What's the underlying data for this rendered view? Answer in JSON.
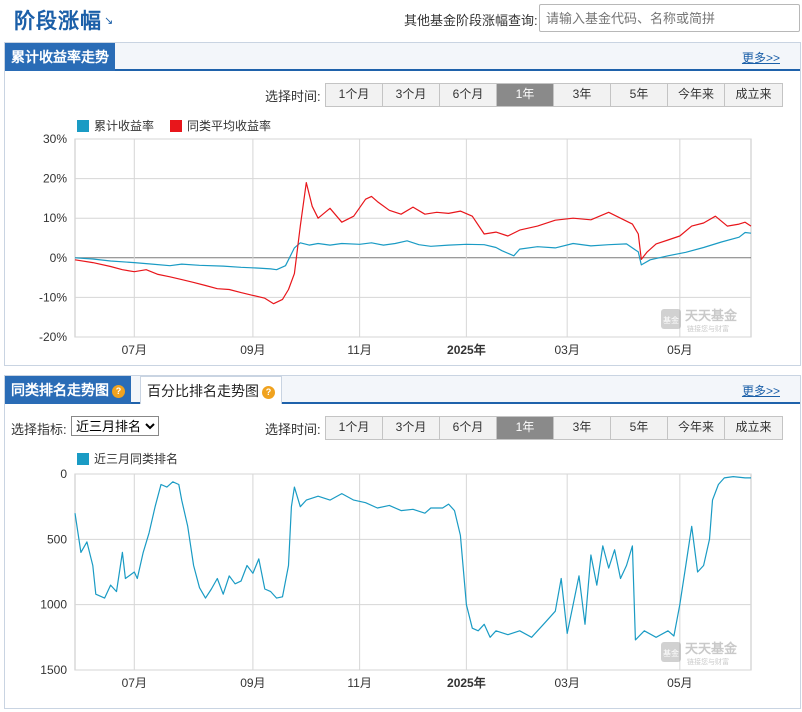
{
  "header": {
    "title": "阶段涨幅",
    "query_label": "其他基金阶段涨幅查询:",
    "query_placeholder": "请输入基金代码、名称或简拼"
  },
  "panel1": {
    "tab": "累计收益率走势",
    "more": "更多>>",
    "range_label": "选择时间:",
    "ranges": [
      "1个月",
      "3个月",
      "6个月",
      "1年",
      "3年",
      "5年",
      "今年来",
      "成立来"
    ],
    "active_range": "1年"
  },
  "panel2": {
    "tab_active": "同类排名走势图",
    "tab_other": "百分比排名走势图",
    "more": "更多>>",
    "metric_label": "选择指标:",
    "metric_value": "近三月排名",
    "range_label": "选择时间:",
    "ranges": [
      "1个月",
      "3个月",
      "6个月",
      "1年",
      "3年",
      "5年",
      "今年来",
      "成立来"
    ],
    "active_range": "1年"
  },
  "watermark": {
    "text": "天天基金",
    "sub": "链接您与财富",
    "badge": "基金"
  },
  "colors": {
    "blue_series": "#1a9bc4",
    "red_series": "#e8161b",
    "tab_blue": "#2a6cb6",
    "title_blue": "#1b5fa8"
  },
  "chart_data": [
    {
      "type": "line",
      "title": "累计收益率走势",
      "xlabel": "",
      "ylabel": "",
      "ylim": [
        -20,
        30
      ],
      "yticks": [
        "30%",
        "20%",
        "10%",
        "0%",
        "-10%",
        "-20%"
      ],
      "ytick_values": [
        30,
        20,
        10,
        0,
        -10,
        -20
      ],
      "xtick_labels": [
        "07月",
        "09月",
        "11月",
        "2025年",
        "03月",
        "05月"
      ],
      "xtick_positions": [
        1.0,
        3.0,
        4.8,
        6.6,
        8.3,
        10.2
      ],
      "xlim": [
        0,
        11.4
      ],
      "grid": true,
      "legend_position": "top-left",
      "series": [
        {
          "name": "累计收益率",
          "color": "#1a9bc4",
          "points": [
            [
              0,
              0
            ],
            [
              0.3,
              -0.3
            ],
            [
              0.6,
              -0.8
            ],
            [
              1.0,
              -1.2
            ],
            [
              1.3,
              -1.6
            ],
            [
              1.6,
              -2.0
            ],
            [
              1.8,
              -1.6
            ],
            [
              2.1,
              -1.9
            ],
            [
              2.5,
              -2.1
            ],
            [
              2.8,
              -2.4
            ],
            [
              3.1,
              -2.6
            ],
            [
              3.3,
              -2.8
            ],
            [
              3.4,
              -3.0
            ],
            [
              3.55,
              -2.0
            ],
            [
              3.7,
              2.5
            ],
            [
              3.8,
              3.8
            ],
            [
              3.95,
              3.2
            ],
            [
              4.1,
              3.6
            ],
            [
              4.3,
              3.2
            ],
            [
              4.5,
              3.6
            ],
            [
              4.8,
              3.4
            ],
            [
              5.0,
              3.8
            ],
            [
              5.2,
              3.2
            ],
            [
              5.4,
              3.6
            ],
            [
              5.6,
              4.3
            ],
            [
              5.8,
              3.3
            ],
            [
              6.0,
              2.9
            ],
            [
              6.3,
              3.2
            ],
            [
              6.6,
              3.4
            ],
            [
              6.9,
              3.3
            ],
            [
              7.1,
              2.6
            ],
            [
              7.2,
              1.8
            ],
            [
              7.4,
              0.5
            ],
            [
              7.5,
              2.2
            ],
            [
              7.8,
              2.8
            ],
            [
              8.1,
              2.5
            ],
            [
              8.4,
              3.6
            ],
            [
              8.7,
              3.0
            ],
            [
              9.0,
              3.3
            ],
            [
              9.3,
              3.5
            ],
            [
              9.5,
              1.5
            ],
            [
              9.55,
              -1.8
            ],
            [
              9.7,
              -0.5
            ],
            [
              10.0,
              0.5
            ],
            [
              10.3,
              1.4
            ],
            [
              10.6,
              2.6
            ],
            [
              10.9,
              4.0
            ],
            [
              11.2,
              5.2
            ],
            [
              11.3,
              6.4
            ],
            [
              11.4,
              6.2
            ]
          ]
        },
        {
          "name": "同类平均收益率",
          "color": "#e8161b",
          "points": [
            [
              0,
              -0.5
            ],
            [
              0.3,
              -1.2
            ],
            [
              0.6,
              -2.2
            ],
            [
              0.8,
              -3.0
            ],
            [
              1.0,
              -3.5
            ],
            [
              1.2,
              -3.0
            ],
            [
              1.4,
              -4.2
            ],
            [
              1.6,
              -4.8
            ],
            [
              1.8,
              -5.5
            ],
            [
              2.0,
              -6.2
            ],
            [
              2.2,
              -7.0
            ],
            [
              2.4,
              -7.8
            ],
            [
              2.6,
              -8.0
            ],
            [
              2.8,
              -8.8
            ],
            [
              3.0,
              -9.5
            ],
            [
              3.2,
              -10.2
            ],
            [
              3.35,
              -11.6
            ],
            [
              3.5,
              -10.5
            ],
            [
              3.6,
              -8.0
            ],
            [
              3.7,
              -4.0
            ],
            [
              3.8,
              8.0
            ],
            [
              3.9,
              19.0
            ],
            [
              4.0,
              13.0
            ],
            [
              4.1,
              10.0
            ],
            [
              4.3,
              12.5
            ],
            [
              4.5,
              9.0
            ],
            [
              4.7,
              10.5
            ],
            [
              4.9,
              14.8
            ],
            [
              5.0,
              15.5
            ],
            [
              5.1,
              14.2
            ],
            [
              5.3,
              12.0
            ],
            [
              5.5,
              11.0
            ],
            [
              5.7,
              12.8
            ],
            [
              5.9,
              11.0
            ],
            [
              6.1,
              11.5
            ],
            [
              6.3,
              11.2
            ],
            [
              6.5,
              11.8
            ],
            [
              6.7,
              10.5
            ],
            [
              6.9,
              6.0
            ],
            [
              7.1,
              6.5
            ],
            [
              7.3,
              5.5
            ],
            [
              7.5,
              7.0
            ],
            [
              7.8,
              8.0
            ],
            [
              8.1,
              9.5
            ],
            [
              8.4,
              10.0
            ],
            [
              8.7,
              9.6
            ],
            [
              9.0,
              11.5
            ],
            [
              9.2,
              10.0
            ],
            [
              9.4,
              8.5
            ],
            [
              9.5,
              6.0
            ],
            [
              9.55,
              -0.4
            ],
            [
              9.65,
              1.5
            ],
            [
              9.8,
              3.5
            ],
            [
              10.0,
              4.5
            ],
            [
              10.2,
              5.5
            ],
            [
              10.4,
              8.0
            ],
            [
              10.6,
              8.8
            ],
            [
              10.8,
              10.5
            ],
            [
              11.0,
              8.0
            ],
            [
              11.2,
              8.5
            ],
            [
              11.3,
              9.0
            ],
            [
              11.4,
              8.0
            ]
          ]
        }
      ]
    },
    {
      "type": "line",
      "title": "同类排名走势图",
      "xlabel": "",
      "ylabel": "",
      "ylim": [
        0,
        1500
      ],
      "y_inverted": true,
      "yticks": [
        "0",
        "500",
        "1000",
        "1500"
      ],
      "ytick_values": [
        0,
        500,
        1000,
        1500
      ],
      "xtick_labels": [
        "07月",
        "09月",
        "11月",
        "2025年",
        "03月",
        "05月"
      ],
      "xtick_positions": [
        1.0,
        3.0,
        4.8,
        6.6,
        8.3,
        10.2
      ],
      "xlim": [
        0,
        11.4
      ],
      "grid": true,
      "legend_position": "top-left",
      "series": [
        {
          "name": "近三月同类排名",
          "color": "#1a9bc4",
          "points": [
            [
              0,
              300
            ],
            [
              0.1,
              600
            ],
            [
              0.2,
              520
            ],
            [
              0.3,
              700
            ],
            [
              0.35,
              920
            ],
            [
              0.5,
              950
            ],
            [
              0.6,
              850
            ],
            [
              0.7,
              900
            ],
            [
              0.8,
              600
            ],
            [
              0.85,
              800
            ],
            [
              1.0,
              750
            ],
            [
              1.05,
              800
            ],
            [
              1.15,
              600
            ],
            [
              1.25,
              450
            ],
            [
              1.35,
              250
            ],
            [
              1.45,
              80
            ],
            [
              1.55,
              100
            ],
            [
              1.65,
              60
            ],
            [
              1.75,
              80
            ],
            [
              1.8,
              200
            ],
            [
              1.9,
              400
            ],
            [
              2.0,
              700
            ],
            [
              2.1,
              870
            ],
            [
              2.2,
              950
            ],
            [
              2.3,
              880
            ],
            [
              2.4,
              800
            ],
            [
              2.5,
              920
            ],
            [
              2.6,
              780
            ],
            [
              2.7,
              840
            ],
            [
              2.8,
              820
            ],
            [
              2.9,
              700
            ],
            [
              3.0,
              760
            ],
            [
              3.1,
              650
            ],
            [
              3.2,
              880
            ],
            [
              3.3,
              900
            ],
            [
              3.4,
              950
            ],
            [
              3.5,
              940
            ],
            [
              3.6,
              700
            ],
            [
              3.65,
              250
            ],
            [
              3.7,
              100
            ],
            [
              3.8,
              250
            ],
            [
              3.9,
              200
            ],
            [
              4.1,
              170
            ],
            [
              4.3,
              200
            ],
            [
              4.5,
              150
            ],
            [
              4.7,
              200
            ],
            [
              4.9,
              220
            ],
            [
              5.1,
              260
            ],
            [
              5.3,
              240
            ],
            [
              5.5,
              280
            ],
            [
              5.7,
              270
            ],
            [
              5.9,
              300
            ],
            [
              6.0,
              260
            ],
            [
              6.2,
              260
            ],
            [
              6.3,
              230
            ],
            [
              6.4,
              280
            ],
            [
              6.5,
              470
            ],
            [
              6.6,
              1000
            ],
            [
              6.7,
              1180
            ],
            [
              6.8,
              1200
            ],
            [
              6.9,
              1150
            ],
            [
              7.0,
              1250
            ],
            [
              7.1,
              1200
            ],
            [
              7.3,
              1230
            ],
            [
              7.5,
              1200
            ],
            [
              7.7,
              1250
            ],
            [
              7.9,
              1150
            ],
            [
              8.1,
              1050
            ],
            [
              8.2,
              800
            ],
            [
              8.3,
              1220
            ],
            [
              8.4,
              1000
            ],
            [
              8.5,
              780
            ],
            [
              8.6,
              1150
            ],
            [
              8.7,
              620
            ],
            [
              8.8,
              850
            ],
            [
              8.9,
              550
            ],
            [
              9.0,
              720
            ],
            [
              9.1,
              580
            ],
            [
              9.2,
              800
            ],
            [
              9.3,
              700
            ],
            [
              9.4,
              550
            ],
            [
              9.45,
              1270
            ],
            [
              9.6,
              1200
            ],
            [
              9.8,
              1250
            ],
            [
              10.0,
              1200
            ],
            [
              10.1,
              1240
            ],
            [
              10.2,
              1000
            ],
            [
              10.3,
              700
            ],
            [
              10.4,
              400
            ],
            [
              10.5,
              750
            ],
            [
              10.6,
              700
            ],
            [
              10.7,
              500
            ],
            [
              10.75,
              200
            ],
            [
              10.85,
              80
            ],
            [
              10.95,
              30
            ],
            [
              11.1,
              20
            ],
            [
              11.3,
              30
            ],
            [
              11.4,
              30
            ]
          ]
        }
      ]
    }
  ]
}
